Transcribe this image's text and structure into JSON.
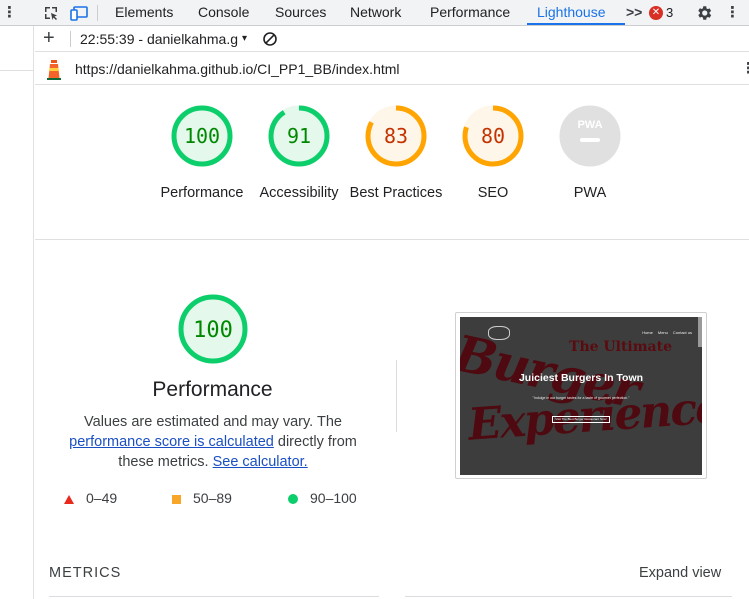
{
  "devtools": {
    "tabs": [
      "Elements",
      "Console",
      "Sources",
      "Network",
      "Performance",
      "Lighthouse"
    ],
    "active_tab": "Lighthouse",
    "more_tabs_icon": "chevron-double-right-icon",
    "error_count": "3",
    "icons": {
      "inspect": "inspect-element-icon",
      "device": "device-toolbar-icon",
      "settings": "gear-icon",
      "menu": "vertical-dots-icon"
    },
    "colors": {
      "accent": "#1a73e8",
      "error": "#d93025"
    }
  },
  "report_bar": {
    "add_label": "+",
    "report_select": "22:55:39 - danielkahma.g",
    "caret": "▾"
  },
  "url_bar": {
    "url": "https://danielkahma.github.io/CI_PP1_BB/index.html"
  },
  "categories": [
    {
      "score": "100",
      "label": "Performance",
      "value": 100,
      "color": "#0cce6b",
      "text_color": "#008800",
      "fill": "#e5f8ec"
    },
    {
      "score": "91",
      "label": "Accessibility",
      "value": 91,
      "color": "#0cce6b",
      "text_color": "#008800",
      "fill": "#e5f8ec"
    },
    {
      "score": "83",
      "label": "Best Practices",
      "value": 83,
      "color": "#ffa400",
      "text_color": "#c33300",
      "fill": "#fff6ea"
    },
    {
      "score": "80",
      "label": "SEO",
      "value": 80,
      "color": "#ffa400",
      "text_color": "#c33300",
      "fill": "#fff6ea"
    },
    {
      "score": "",
      "label": "PWA",
      "value": null,
      "badge": "PWA",
      "color": "#dadada",
      "text_color": "#9e9e9e",
      "fill": "#e0e0e0"
    }
  ],
  "performance": {
    "score": "100",
    "title": "Performance",
    "desc_1": "Values are estimated and may vary. The",
    "link_1": "performance score is calculated",
    "desc_2": "directly from these metrics.",
    "link_2": "See calculator.",
    "legend": [
      {
        "range": "0–49",
        "shape": "triangle",
        "color": "#e8291c"
      },
      {
        "range": "50–89",
        "shape": "square",
        "color": "#f7a627"
      },
      {
        "range": "90–100",
        "shape": "circle",
        "color": "#0cce6b"
      }
    ]
  },
  "screenshot": {
    "nav": [
      "Home",
      "Menu",
      "Contact us"
    ],
    "headline": "The Ultimate",
    "script_top": "Burger",
    "script_bottom": "Experience",
    "subheading": "Juiciest Burgers In Town",
    "tagline": "\"Indulge in our burger tastes for a taste of gourmet perfection.\"",
    "button": "Visit The Best Burger Restaurant Now!"
  },
  "metrics": {
    "label": "METRICS",
    "expand": "Expand view"
  }
}
